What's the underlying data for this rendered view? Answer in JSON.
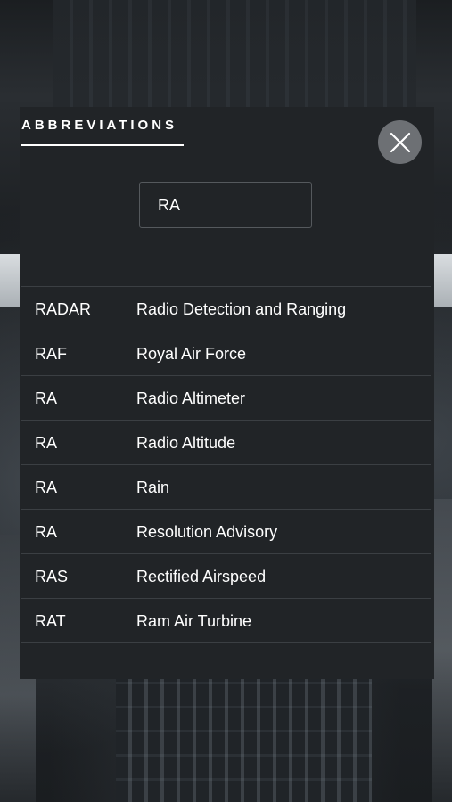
{
  "header": {
    "title": "ABBREVIATIONS"
  },
  "search": {
    "value": "RA"
  },
  "results": [
    {
      "abbr": "RADAR",
      "meaning": "Radio Detection and Ranging"
    },
    {
      "abbr": "RAF",
      "meaning": "Royal Air Force"
    },
    {
      "abbr": "RA",
      "meaning": "Radio Altimeter"
    },
    {
      "abbr": "RA",
      "meaning": "Radio Altitude"
    },
    {
      "abbr": "RA",
      "meaning": "Rain"
    },
    {
      "abbr": "RA",
      "meaning": "Resolution Advisory"
    },
    {
      "abbr": "RAS",
      "meaning": "Rectified Airspeed"
    },
    {
      "abbr": "RAT",
      "meaning": "Ram Air Turbine"
    }
  ],
  "icons": {
    "close": "close-icon"
  },
  "colors": {
    "panel": "#212427",
    "close_button": "#6d7074",
    "text": "#ffffff"
  }
}
